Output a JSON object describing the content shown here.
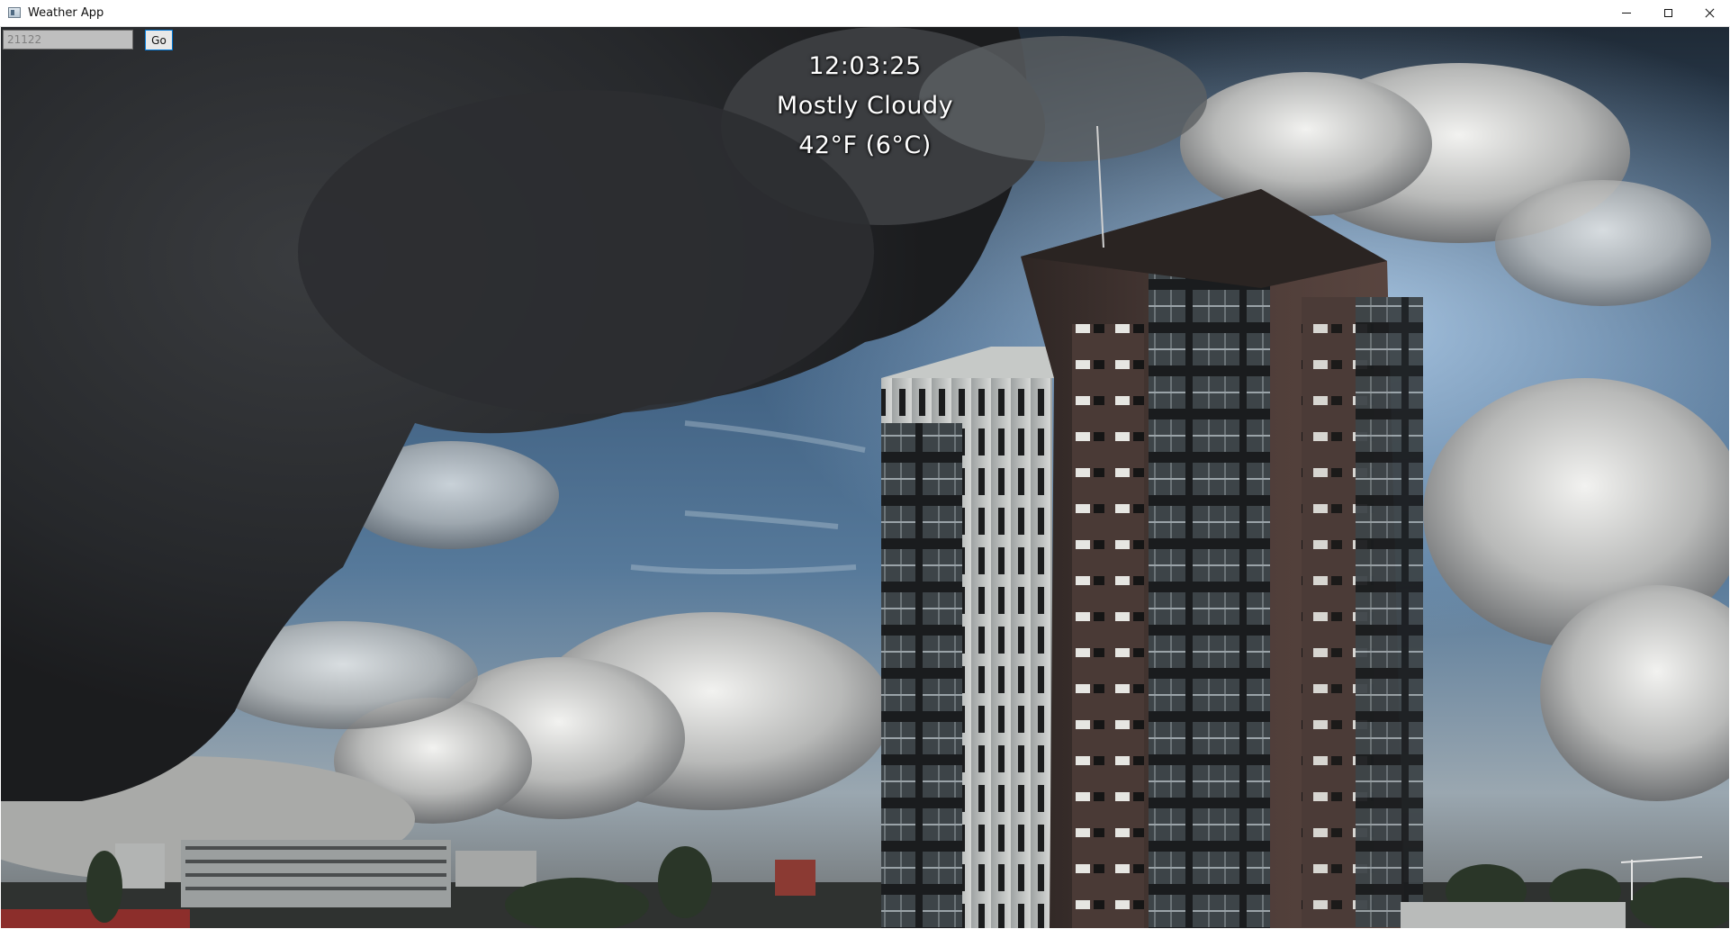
{
  "window": {
    "title": "Weather App",
    "controls": {
      "minimize_icon": "minimize-icon",
      "maximize_icon": "maximize-icon",
      "close_icon": "close-icon"
    }
  },
  "search": {
    "zip_value": "",
    "zip_placeholder": "21122",
    "go_label": "Go"
  },
  "weather": {
    "time": "12:03:25",
    "condition": "Mostly Cloudy",
    "temperature": "42°F (6°C)"
  },
  "background": {
    "description_icon": "cloudy-city-photo",
    "colors": {
      "sky_blue": "#3f6c99",
      "storm_cloud": "#2b2d30",
      "building_brick": "#4a3a36",
      "building_light": "#c9cbc8"
    }
  }
}
